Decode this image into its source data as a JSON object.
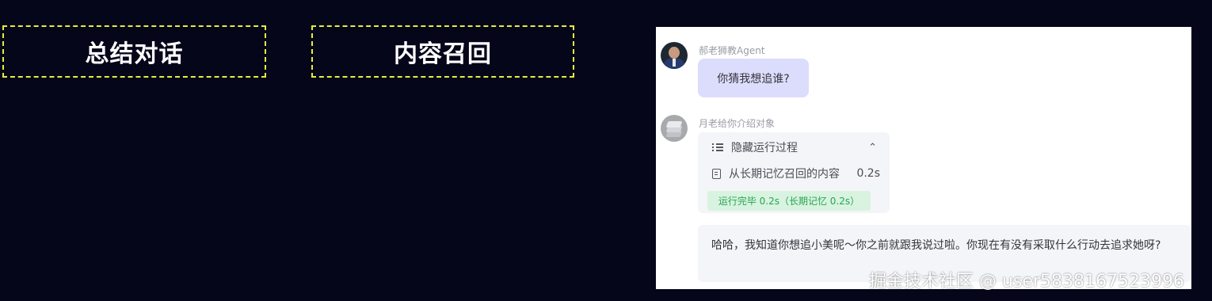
{
  "steps": [
    {
      "label": "总结对话"
    },
    {
      "label": "内容召回"
    }
  ],
  "chat": {
    "user_message": {
      "sender": "郝老狮教Agent",
      "text": "你猜我想追谁?"
    },
    "bot_message": {
      "sender": "月老给你介绍对象",
      "process_toggle_label": "隐藏运行过程",
      "process_step_label": "从长期记忆召回的内容",
      "process_step_time": "0.2s",
      "status_badge": "运行完毕 0.2s（长期记忆 0.2s）",
      "reply_text": "哈哈，我知道你想追小美呢～你之前就跟我说过啦。你现在有没有采取什么行动去追求她呀?"
    }
  },
  "watermark": "掘金技术社区 @ user5838167523996",
  "colors": {
    "background": "#05061a",
    "dashed_border": "#e6ee3c",
    "user_bubble": "#dcdcfc",
    "status_badge_bg": "#d8f3e0",
    "status_badge_text": "#27a552"
  },
  "icons": {
    "process_toggle": "list-icon",
    "collapse": "chevron-up-icon",
    "process_step": "document-icon"
  }
}
